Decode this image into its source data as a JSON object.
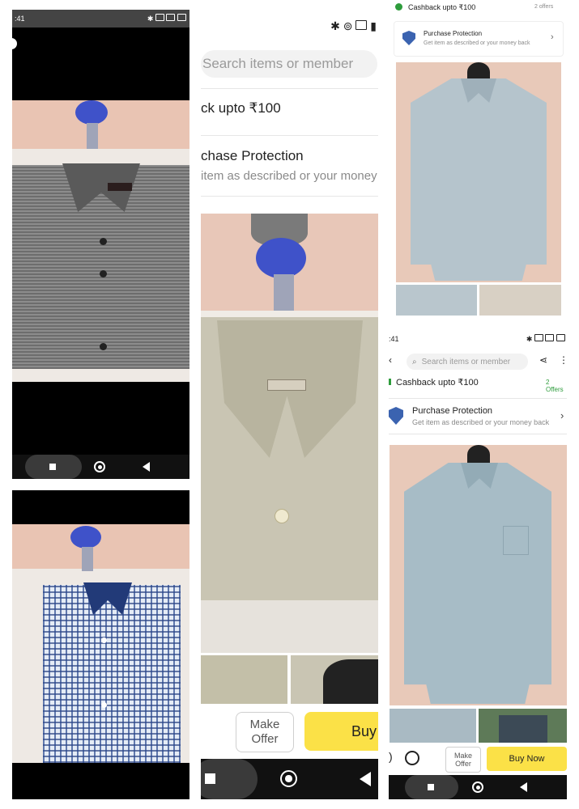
{
  "panels": {
    "top_left": {
      "status_time": ":41",
      "status_badges": [
        "S",
        "4G",
        "5G"
      ]
    },
    "middle": {
      "search_placeholder": "Search items or member",
      "cashback_text": "ck upto ₹100",
      "protection_title": "chase Protection",
      "protection_sub": "item as described or your money",
      "make_offer_line1": "Make",
      "make_offer_line2": "Offer",
      "buy_label": "Buy"
    },
    "top_right": {
      "cashback_text": "Cashback upto ₹100",
      "offers_text": "2 offers",
      "protection_title": "Purchase Protection",
      "protection_sub": "Get item as described or your money back"
    },
    "bottom_right": {
      "status_time": ":41",
      "search_placeholder": "Search items or member",
      "cashback_text": "Cashback upto ₹100",
      "offers_text": "2 Offers",
      "protection_title": "Purchase Protection",
      "protection_sub": "Get item as described or your money back",
      "make_offer_line1": "Make",
      "make_offer_line2": "Offer",
      "buy_label": "Buy Now"
    }
  },
  "colors": {
    "accent_yellow": "#fbe147",
    "shield_blue": "#3b63b0",
    "offers_green": "#2e9c3c"
  },
  "icons": [
    "bluetooth-icon",
    "wifi-icon",
    "signal-icon",
    "battery-icon",
    "search-icon",
    "share-icon",
    "more-icon",
    "shield-icon",
    "chevron-right-icon",
    "chat-icon",
    "back-arrow-icon",
    "square-nav-icon",
    "home-nav-icon",
    "back-nav-icon"
  ]
}
